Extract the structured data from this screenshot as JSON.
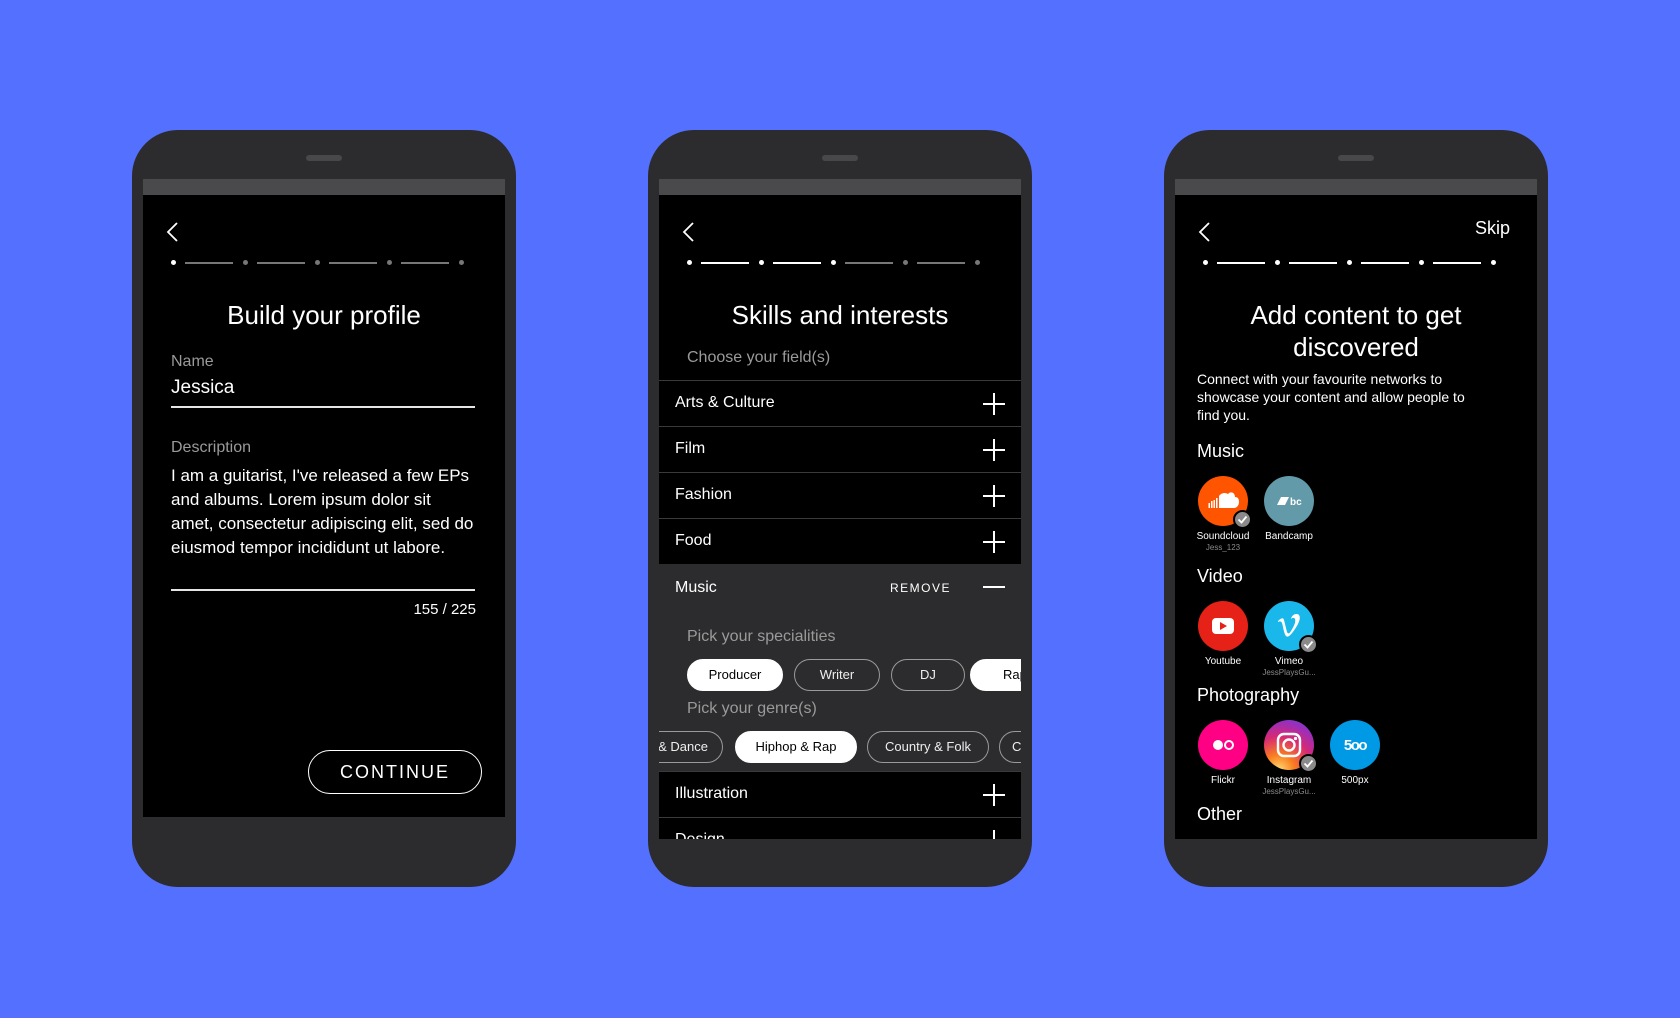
{
  "colors": {
    "background": "#5470ff",
    "phone": "#2c2c2e",
    "screen": "#000000",
    "accent": "#ffffff"
  },
  "phone1": {
    "title": "Build your profile",
    "name_label": "Name",
    "name_value": "Jessica",
    "description_label": "Description",
    "description_value": "I am a guitarist, I've released a few EPs and albums.  Lorem ipsum dolor sit amet, consectetur adipiscing elit, sed do eiusmod tempor incididunt ut labore.",
    "char_counter": "155 / 225",
    "continue_label": "CONTINUE",
    "progress_step": 1,
    "progress_total": 5
  },
  "phone2": {
    "title": "Skills and interests",
    "subtitle": "Choose your field(s)",
    "fields": [
      "Arts & Culture",
      "Film",
      "Fashion",
      "Food"
    ],
    "expanded_field": "Music",
    "remove_label": "REMOVE",
    "specialities_label": "Pick your specialities",
    "specialities": [
      {
        "label": "Producer",
        "selected": true
      },
      {
        "label": "Writer",
        "selected": false
      },
      {
        "label": "DJ",
        "selected": false
      },
      {
        "label": "Rap",
        "selected": true
      }
    ],
    "genres_label": "Pick your genre(s)",
    "genres": [
      {
        "label": "Electronic & Dance",
        "selected": false
      },
      {
        "label": "Hiphop & Rap",
        "selected": true
      },
      {
        "label": "Country & Folk",
        "selected": false
      },
      {
        "label": "Classical",
        "selected": false
      }
    ],
    "after_fields": [
      "Illustration",
      "Design"
    ],
    "progress_step": 2,
    "progress_total": 5
  },
  "phone3": {
    "skip_label": "Skip",
    "title_line1": "Add content to get",
    "title_line2": "discovered",
    "description": "Connect with your favourite networks to showcase your content and allow people to find you.",
    "sections": {
      "music": "Music",
      "video": "Video",
      "photography": "Photography",
      "other": "Other"
    },
    "networks": {
      "soundcloud": {
        "name": "Soundcloud",
        "user": "Jess_123",
        "connected": true,
        "color": "#ff5500",
        "icon": "soundcloud-icon"
      },
      "bandcamp": {
        "name": "Bandcamp",
        "user": "",
        "connected": false,
        "color": "#629aa9",
        "icon": "bandcamp-icon"
      },
      "youtube": {
        "name": "Youtube",
        "user": "",
        "connected": false,
        "color": "#e62117",
        "icon": "youtube-icon"
      },
      "vimeo": {
        "name": "Vimeo",
        "user": "JessPlaysGu...",
        "connected": true,
        "color": "#1ab7ea",
        "icon": "vimeo-icon"
      },
      "flickr": {
        "name": "Flickr",
        "user": "",
        "connected": false,
        "color": "#ff0084",
        "icon": "flickr-icon"
      },
      "instagram": {
        "name": "Instagram",
        "user": "JessPlaysGu...",
        "connected": true,
        "color": "#c13584",
        "icon": "instagram-icon"
      },
      "fivehundredpx": {
        "name": "500px",
        "user": "",
        "connected": false,
        "color": "#0099e5",
        "icon": "500px-icon",
        "glyph": "5oo"
      }
    },
    "progress_step": 5,
    "progress_total": 5
  }
}
